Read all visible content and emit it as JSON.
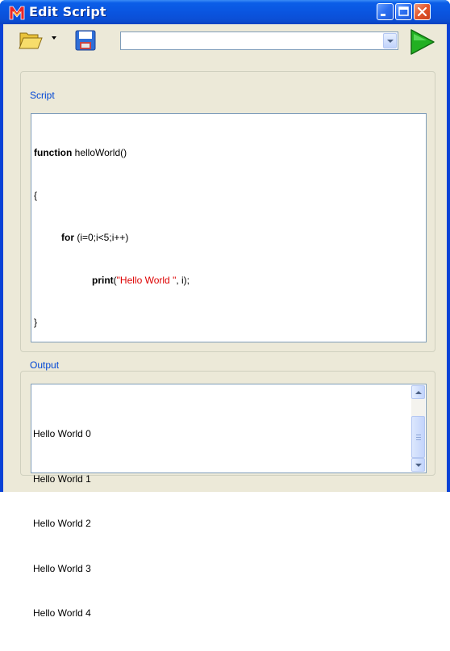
{
  "window": {
    "title": "Edit Script",
    "app_icon": "m-logo-icon",
    "controls": [
      "minimize-icon",
      "maximize-icon",
      "close-icon"
    ]
  },
  "toolbar": {
    "open_icon": "folder-open-icon",
    "save_icon": "floppy-disk-icon",
    "script_selector_value": "",
    "run_icon": "play-icon"
  },
  "script": {
    "legend": "Script",
    "lines": [
      {
        "kw": "function",
        "rest": " helloWorld()"
      },
      {
        "plain": "{"
      },
      {
        "kw": "for",
        "rest": " (i=0;i<5;i++)"
      },
      {
        "kw": "print",
        "pre": "(",
        "str": "\"Hello World \"",
        "post": ", i);"
      },
      {
        "plain": "}"
      }
    ]
  },
  "output": {
    "legend": "Output",
    "lines": [
      "Hello World 0",
      "Hello World 1",
      "Hello World 2",
      "Hello World 3",
      "Hello World 4"
    ]
  },
  "colors": {
    "title_bar": "#0a55e0",
    "window_bg": "#ece9d8",
    "legend_text": "#0046d5",
    "string_literal": "#dd0000",
    "close_button": "#e2552a",
    "run_arrow": "#22b022"
  }
}
